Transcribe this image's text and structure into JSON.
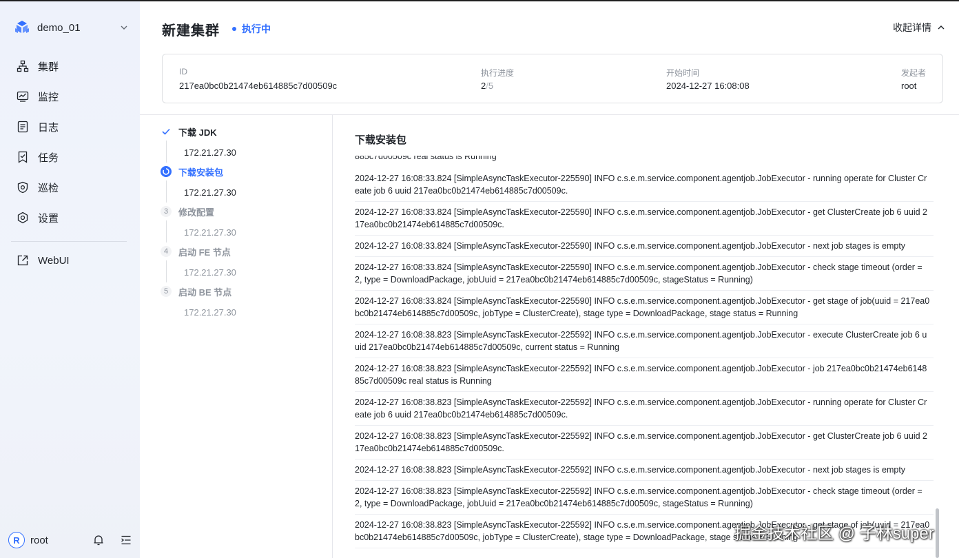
{
  "sidebar": {
    "workspace": "demo_01",
    "items": [
      {
        "label": "集群",
        "icon": "cluster-icon"
      },
      {
        "label": "监控",
        "icon": "monitor-icon"
      },
      {
        "label": "日志",
        "icon": "log-icon"
      },
      {
        "label": "任务",
        "icon": "task-icon"
      },
      {
        "label": "巡检",
        "icon": "inspection-icon"
      },
      {
        "label": "设置",
        "icon": "settings-icon"
      }
    ],
    "webui": "WebUI",
    "user": {
      "initial": "R",
      "name": "root"
    }
  },
  "header": {
    "title": "新建集群",
    "status": "执行中",
    "collapse": "收起详情"
  },
  "info": {
    "id_label": "ID",
    "id_value": "217ea0bc0b21474eb614885c7d00509c",
    "progress_label": "执行进度",
    "progress_current": "2",
    "progress_sep": "/",
    "progress_total": "5",
    "start_label": "开始时间",
    "start_value": "2024-12-27 16:08:08",
    "initiator_label": "发起者",
    "initiator_value": "root"
  },
  "steps": [
    {
      "name": "下载 JDK",
      "host": "172.21.27.30",
      "state": "done"
    },
    {
      "name": "下载安装包",
      "host": "172.21.27.30",
      "state": "active"
    },
    {
      "number": "3",
      "name": "修改配置",
      "host": "172.21.27.30",
      "state": "todo"
    },
    {
      "number": "4",
      "name": "启动 FE 节点",
      "host": "172.21.27.30",
      "state": "todo"
    },
    {
      "number": "5",
      "name": "启动 BE 节点",
      "host": "172.21.27.30",
      "state": "todo"
    }
  ],
  "log": {
    "title": "下载安装包",
    "cut_line": "885c7d00509c real status is Running",
    "entries": [
      "2024-12-27 16:08:33.824 [SimpleAsyncTaskExecutor-225590] INFO  c.s.e.m.service.component.agentjob.JobExecutor - running operate for Cluster Create job 6 uuid 217ea0bc0b21474eb614885c7d00509c.",
      "2024-12-27 16:08:33.824 [SimpleAsyncTaskExecutor-225590] INFO  c.s.e.m.service.component.agentjob.JobExecutor - get ClusterCreate job 6 uuid 217ea0bc0b21474eb614885c7d00509c.",
      "2024-12-27 16:08:33.824 [SimpleAsyncTaskExecutor-225590] INFO  c.s.e.m.service.component.agentjob.JobExecutor - next job stages is empty",
      "2024-12-27 16:08:33.824 [SimpleAsyncTaskExecutor-225590] INFO  c.s.e.m.service.component.agentjob.JobExecutor - check stage timeout (order = 2, type = DownloadPackage, jobUuid = 217ea0bc0b21474eb614885c7d00509c, stageStatus = Running)",
      "2024-12-27 16:08:33.824 [SimpleAsyncTaskExecutor-225590] INFO  c.s.e.m.service.component.agentjob.JobExecutor - get stage of job(uuid = 217ea0bc0b21474eb614885c7d00509c, jobType = ClusterCreate), stage type = DownloadPackage, stage status = Running",
      "2024-12-27 16:08:38.823 [SimpleAsyncTaskExecutor-225592] INFO  c.s.e.m.service.component.agentjob.JobExecutor - execute ClusterCreate job 6 uuid 217ea0bc0b21474eb614885c7d00509c, current status = Running",
      "2024-12-27 16:08:38.823 [SimpleAsyncTaskExecutor-225592] INFO  c.s.e.m.service.component.agentjob.JobExecutor - job 217ea0bc0b21474eb614885c7d00509c real status is Running",
      "2024-12-27 16:08:38.823 [SimpleAsyncTaskExecutor-225592] INFO  c.s.e.m.service.component.agentjob.JobExecutor - running operate for Cluster Create job 6 uuid 217ea0bc0b21474eb614885c7d00509c.",
      "2024-12-27 16:08:38.823 [SimpleAsyncTaskExecutor-225592] INFO  c.s.e.m.service.component.agentjob.JobExecutor - get ClusterCreate job 6 uuid 217ea0bc0b21474eb614885c7d00509c.",
      "2024-12-27 16:08:38.823 [SimpleAsyncTaskExecutor-225592] INFO  c.s.e.m.service.component.agentjob.JobExecutor - next job stages is empty",
      "2024-12-27 16:08:38.823 [SimpleAsyncTaskExecutor-225592] INFO  c.s.e.m.service.component.agentjob.JobExecutor - check stage timeout (order = 2, type = DownloadPackage, jobUuid = 217ea0bc0b21474eb614885c7d00509c, stageStatus = Running)",
      "2024-12-27 16:08:38.823 [SimpleAsyncTaskExecutor-225592] INFO  c.s.e.m.service.component.agentjob.JobExecutor - get stage of job(uuid = 217ea0bc0b21474eb614885c7d00509c, jobType = ClusterCreate), stage type = DownloadPackage, stage status = Running"
    ]
  },
  "watermark": "掘金技术社区 @ 子林super",
  "colors": {
    "accent": "#3370ff",
    "text": "#1f2329",
    "muted": "#8f959e"
  }
}
